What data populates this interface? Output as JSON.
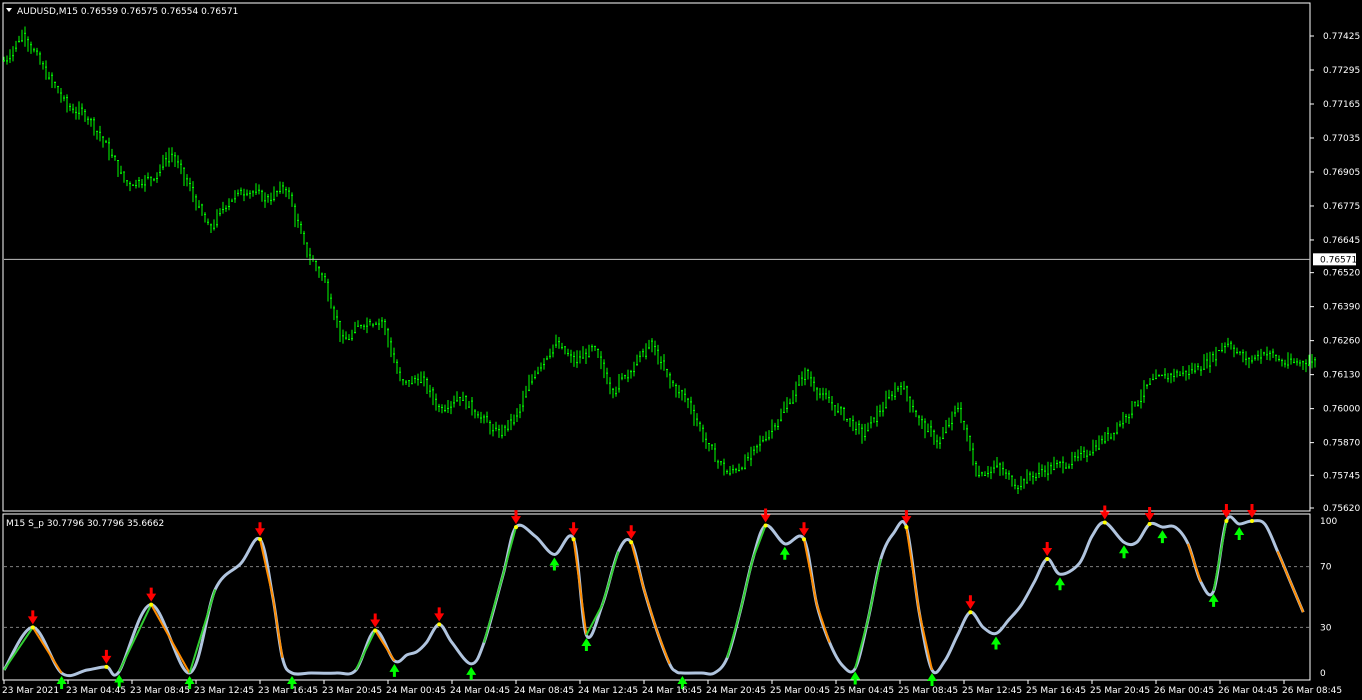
{
  "main": {
    "header": "AUDUSD,M15  0.76559 0.76575 0.76554 0.76571",
    "ticks": [
      "0.77425",
      "0.77295",
      "0.77165",
      "0.77035",
      "0.76905",
      "0.76775",
      "0.76645",
      "0.76520",
      "0.76390",
      "0.76260",
      "0.76130",
      "0.76000",
      "0.75870",
      "0.75745",
      "0.75620"
    ],
    "tick_values": [
      0.77425,
      0.77295,
      0.77165,
      0.77035,
      0.76905,
      0.76775,
      0.76645,
      0.7652,
      0.7639,
      0.7626,
      0.7613,
      0.76,
      0.7587,
      0.75745,
      0.7562
    ],
    "ylim": [
      0.7562,
      0.7751
    ],
    "current_price": 0.76571,
    "current_price_label": "0.76571",
    "colors": {
      "bull": "#00ff00",
      "bear": "#00ff00",
      "bg": "#000000",
      "frame": "#ffffff"
    }
  },
  "indicator": {
    "header": "M15 S_p 30.7796 30.7796 35.6662",
    "ticks": [
      "100",
      "70",
      "30",
      "0"
    ],
    "tick_values": [
      100,
      70,
      30,
      0
    ],
    "levels": [
      70,
      30
    ],
    "colors": {
      "main_line": "#b0c4de",
      "up": "#32cd32",
      "down": "#ff8c00",
      "signal": "#ffff00",
      "buy_arrow": "#00ff00",
      "sell_arrow": "#ff0000"
    }
  },
  "x_labels": [
    "23 Mar 2021",
    "23 Mar 04:45",
    "23 Mar 08:45",
    "23 Mar 12:45",
    "23 Mar 16:45",
    "23 Mar 20:45",
    "24 Mar 00:45",
    "24 Mar 04:45",
    "24 Mar 08:45",
    "24 Mar 12:45",
    "24 Mar 16:45",
    "24 Mar 20:45",
    "25 Mar 00:45",
    "25 Mar 04:45",
    "25 Mar 08:45",
    "25 Mar 12:45",
    "25 Mar 16:45",
    "25 Mar 20:45",
    "26 Mar 00:45",
    "26 Mar 04:45",
    "26 Mar 08:45"
  ],
  "chart_data": [
    {
      "type": "line",
      "title": "AUDUSD,M15",
      "ohlc_last": {
        "open": 0.76559,
        "high": 0.76575,
        "low": 0.76554,
        "close": 0.76571
      },
      "x": [
        "23 Mar 2021",
        "23 Mar 04:45",
        "23 Mar 08:45",
        "23 Mar 12:45",
        "23 Mar 16:45",
        "23 Mar 20:45",
        "24 Mar 00:45",
        "24 Mar 04:45",
        "24 Mar 08:45",
        "24 Mar 12:45",
        "24 Mar 16:45",
        "24 Mar 20:45",
        "25 Mar 00:45",
        "25 Mar 04:45",
        "25 Mar 08:45",
        "25 Mar 12:45",
        "25 Mar 16:45",
        "25 Mar 20:45",
        "26 Mar 00:45",
        "26 Mar 04:45",
        "26 Mar 08:45"
      ],
      "path_t": [
        0,
        0.3,
        0.6,
        1.0,
        1.3,
        1.6,
        1.9,
        2.3,
        2.6,
        2.9,
        3.2,
        3.5,
        3.8,
        4.1,
        4.4,
        4.7,
        5.0,
        5.3,
        5.6,
        5.9,
        6.2,
        6.5,
        6.8,
        7.1,
        7.4,
        7.7,
        8.0,
        8.3,
        8.6,
        8.9,
        9.2,
        9.5,
        9.8,
        10.1,
        10.4,
        10.7,
        11.0,
        11.3,
        11.6,
        11.9,
        12.2,
        12.5,
        12.8,
        13.1,
        13.4,
        13.7,
        14.0,
        14.3,
        14.6,
        14.9,
        15.2,
        15.5,
        15.8,
        16.1,
        16.4,
        16.7,
        17.0,
        17.3,
        17.6,
        17.9,
        18.2,
        18.5,
        18.8,
        19.1,
        19.4,
        19.7,
        20.0,
        20.3
      ],
      "path_v": [
        0.7733,
        0.7744,
        0.773,
        0.7715,
        0.7712,
        0.77,
        0.7686,
        0.7688,
        0.7698,
        0.7684,
        0.7668,
        0.768,
        0.7684,
        0.768,
        0.7685,
        0.7661,
        0.7649,
        0.7625,
        0.7633,
        0.7634,
        0.7609,
        0.7612,
        0.76,
        0.7605,
        0.7598,
        0.759,
        0.7597,
        0.7615,
        0.7625,
        0.7618,
        0.7623,
        0.7607,
        0.7616,
        0.7625,
        0.761,
        0.7602,
        0.7585,
        0.7575,
        0.758,
        0.759,
        0.76,
        0.7614,
        0.7604,
        0.7598,
        0.759,
        0.76,
        0.761,
        0.7595,
        0.7587,
        0.7601,
        0.7575,
        0.7578,
        0.7571,
        0.7575,
        0.7578,
        0.758,
        0.7585,
        0.7591,
        0.76,
        0.761,
        0.7613,
        0.7614,
        0.7618,
        0.7626,
        0.7618,
        0.7622,
        0.7617,
        0.7618
      ]
    },
    {
      "type": "line",
      "title": "S_p",
      "header_values": [
        30.7796,
        30.7796,
        35.6662
      ],
      "ylim": [
        0,
        100
      ],
      "levels": [
        70,
        30
      ],
      "x": [
        "23 Mar 2021",
        "23 Mar 04:45",
        "23 Mar 08:45",
        "23 Mar 12:45",
        "23 Mar 16:45",
        "23 Mar 20:45",
        "24 Mar 00:45",
        "24 Mar 04:45",
        "24 Mar 08:45",
        "24 Mar 12:45",
        "24 Mar 16:45",
        "24 Mar 20:45",
        "25 Mar 00:45",
        "25 Mar 04:45",
        "25 Mar 08:45",
        "25 Mar 12:45",
        "25 Mar 16:45",
        "25 Mar 20:45",
        "26 Mar 00:45",
        "26 Mar 04:45",
        "26 Mar 08:45"
      ],
      "t": [
        0,
        0.45,
        0.9,
        1.3,
        1.6,
        1.8,
        2.3,
        2.9,
        3.3,
        3.7,
        4.0,
        4.2,
        4.35,
        4.5,
        4.8,
        5.2,
        5.5,
        5.8,
        6.1,
        6.3,
        6.45,
        6.6,
        6.8,
        7.0,
        7.3,
        7.5,
        7.8,
        8.0,
        8.3,
        8.6,
        8.9,
        9.1,
        9.35,
        9.6,
        9.8,
        10.0,
        10.2,
        10.4,
        10.5,
        10.6,
        10.9,
        11.1,
        11.3,
        11.5,
        11.7,
        11.9,
        12.2,
        12.5,
        12.7,
        12.9,
        13.1,
        13.3,
        13.5,
        13.7,
        13.9,
        14.1,
        14.3,
        14.5,
        14.7,
        14.9,
        15.1,
        15.3,
        15.5,
        15.7,
        15.9,
        16.1,
        16.3,
        16.5,
        16.8,
        17.0,
        17.2,
        17.5,
        17.7,
        17.9,
        18.1,
        18.3,
        18.5,
        18.7,
        18.9,
        19.1,
        19.3,
        19.5,
        19.7,
        19.9,
        20.1,
        20.3
      ],
      "v": [
        2,
        30,
        0,
        2,
        4,
        1,
        45,
        0,
        55,
        72,
        88,
        50,
        10,
        0,
        0,
        0,
        2,
        28,
        8,
        12,
        14,
        20,
        32,
        20,
        6,
        20,
        65,
        96,
        90,
        78,
        88,
        25,
        45,
        80,
        86,
        55,
        28,
        6,
        1,
        0,
        0,
        0,
        10,
        40,
        75,
        97,
        85,
        88,
        45,
        20,
        5,
        3,
        35,
        75,
        92,
        96,
        40,
        2,
        8,
        25,
        40,
        30,
        26,
        35,
        45,
        60,
        75,
        65,
        72,
        90,
        99,
        86,
        86,
        98,
        96,
        96,
        85,
        60,
        54,
        100,
        98,
        100,
        98,
        80,
        60,
        40
      ]
    }
  ]
}
